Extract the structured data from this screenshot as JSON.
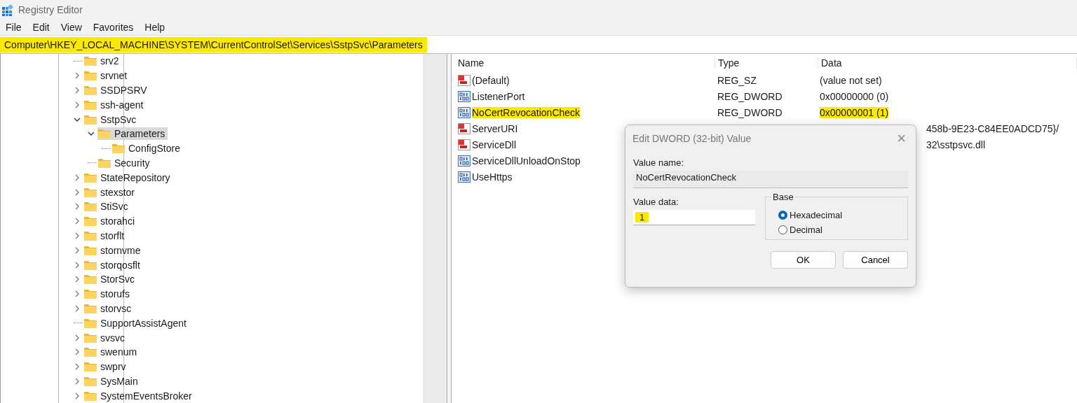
{
  "window": {
    "title": "Registry Editor"
  },
  "menu": [
    "File",
    "Edit",
    "View",
    "Favorites",
    "Help"
  ],
  "address": {
    "path": "Computer\\HKEY_LOCAL_MACHINE\\SYSTEM\\CurrentControlSet\\Services\\SstpSvc\\Parameters",
    "highlighted": true
  },
  "tree": [
    {
      "label": "srv2",
      "kind": "leaf",
      "selected": false
    },
    {
      "label": "srvnet",
      "kind": "branch",
      "expanded": false,
      "selected": false
    },
    {
      "label": "SSDPSRV",
      "kind": "branch",
      "expanded": false,
      "selected": false
    },
    {
      "label": "ssh-agent",
      "kind": "branch",
      "expanded": false,
      "selected": false
    },
    {
      "label": "SstpSvc",
      "kind": "branch",
      "expanded": true,
      "selected": false,
      "children": [
        {
          "label": "Parameters",
          "kind": "branch",
          "expanded": true,
          "selected": true,
          "children": [
            {
              "label": "ConfigStore",
              "kind": "leaf",
              "selected": false
            }
          ]
        },
        {
          "label": "Security",
          "kind": "leaf",
          "selected": false
        }
      ]
    },
    {
      "label": "StateRepository",
      "kind": "branch",
      "expanded": false,
      "selected": false
    },
    {
      "label": "stexstor",
      "kind": "branch",
      "expanded": false,
      "selected": false
    },
    {
      "label": "StiSvc",
      "kind": "branch",
      "expanded": false,
      "selected": false
    },
    {
      "label": "storahci",
      "kind": "branch",
      "expanded": false,
      "selected": false
    },
    {
      "label": "storflt",
      "kind": "branch",
      "expanded": false,
      "selected": false
    },
    {
      "label": "stornvme",
      "kind": "branch",
      "expanded": false,
      "selected": false
    },
    {
      "label": "storqosflt",
      "kind": "branch",
      "expanded": false,
      "selected": false
    },
    {
      "label": "StorSvc",
      "kind": "branch",
      "expanded": false,
      "selected": false
    },
    {
      "label": "storufs",
      "kind": "branch",
      "expanded": false,
      "selected": false
    },
    {
      "label": "storvsc",
      "kind": "branch",
      "expanded": false,
      "selected": false
    },
    {
      "label": "SupportAssistAgent",
      "kind": "leaf",
      "selected": false
    },
    {
      "label": "svsvc",
      "kind": "branch",
      "expanded": false,
      "selected": false
    },
    {
      "label": "swenum",
      "kind": "branch",
      "expanded": false,
      "selected": false
    },
    {
      "label": "swprv",
      "kind": "branch",
      "expanded": false,
      "selected": false
    },
    {
      "label": "SysMain",
      "kind": "branch",
      "expanded": false,
      "selected": false
    },
    {
      "label": "SystemEventsBroker",
      "kind": "branch",
      "expanded": false,
      "selected": false
    }
  ],
  "values": {
    "columns": [
      "Name",
      "Type",
      "Data"
    ],
    "rows": [
      {
        "kind": "string",
        "name": "(Default)",
        "type": "REG_SZ",
        "data": "(value not set)",
        "name_highlighted": false,
        "data_highlighted": false
      },
      {
        "kind": "dword",
        "name": "ListenerPort",
        "type": "REG_DWORD",
        "data": "0x00000000 (0)",
        "name_highlighted": false,
        "data_highlighted": false
      },
      {
        "kind": "dword",
        "name": "NoCertRevocationCheck",
        "type": "REG_DWORD",
        "data": "0x00000001 (1)",
        "name_highlighted": true,
        "data_highlighted": true
      },
      {
        "kind": "string",
        "name": "ServerURI",
        "data_tail": "458b-9E23-C84EE0ADCD75}/",
        "name_highlighted": false
      },
      {
        "kind": "string",
        "name": "ServiceDll",
        "data_tail": "32\\sstpsvc.dll",
        "name_highlighted": false
      },
      {
        "kind": "dword",
        "name": "ServiceDllUnloadOnStop",
        "name_highlighted": false
      },
      {
        "kind": "dword",
        "name": "UseHttps",
        "name_highlighted": false
      }
    ]
  },
  "dialog": {
    "title": "Edit DWORD (32-bit) Value",
    "close": "×",
    "value_name_label": "Value name:",
    "value_name": "NoCertRevocationCheck",
    "value_data_label": "Value data:",
    "value_data": "1",
    "value_data_highlighted": true,
    "base_label": "Base",
    "bases": [
      {
        "label": "Hexadecimal",
        "selected": true
      },
      {
        "label": "Decimal",
        "selected": false
      }
    ],
    "buttons": [
      "OK",
      "Cancel"
    ]
  }
}
